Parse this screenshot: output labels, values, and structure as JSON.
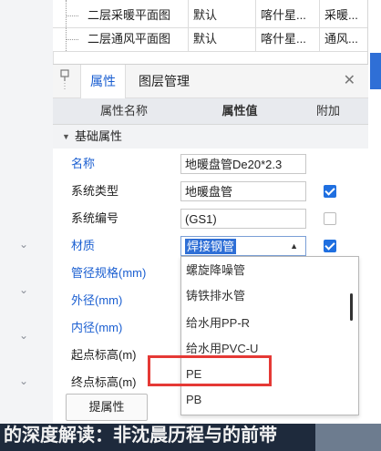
{
  "layers": {
    "rows": [
      {
        "name": "二层采暖平面图",
        "type": "默认",
        "author": "喀什星...",
        "extra": "采暖..."
      },
      {
        "name": "二层通风平面图",
        "type": "默认",
        "author": "喀什星...",
        "extra": "通风..."
      }
    ]
  },
  "panel": {
    "tabs": [
      {
        "label": "属性",
        "active": true
      },
      {
        "label": "图层管理",
        "active": false
      }
    ],
    "close_icon": "close-icon",
    "lock_icon": "pin-icon",
    "columns": {
      "name": "属性名称",
      "value": "属性值",
      "add": "附加"
    },
    "group_label": "基础属性",
    "rows": [
      {
        "name": "名称",
        "value": "地暖盘管De20*2.3",
        "blue": true,
        "checkbox": null
      },
      {
        "name": "系统类型",
        "value": "地暖盘管",
        "blue": false,
        "checkbox": true
      },
      {
        "name": "系统编号",
        "value": "(GS1)",
        "blue": false,
        "checkbox": false
      },
      {
        "name": "材质",
        "value": "焊接钢管",
        "blue": true,
        "checkbox": true
      },
      {
        "name": "管径规格(mm)",
        "value": "",
        "blue": true,
        "checkbox": null
      },
      {
        "name": "外径(mm)",
        "value": "",
        "blue": true,
        "checkbox": null
      },
      {
        "name": "内径(mm)",
        "value": "",
        "blue": true,
        "checkbox": null
      },
      {
        "name": "起点标高(m)",
        "value": "",
        "blue": false,
        "checkbox": null
      },
      {
        "name": "终点标高(m)",
        "value": "",
        "blue": false,
        "checkbox": null
      }
    ]
  },
  "dropdown": {
    "options": [
      "螺旋降噪管",
      "铸铁排水管",
      "给水用PP-R",
      "给水用PVC-U",
      "PE",
      "PB"
    ],
    "highlighted": "PE",
    "highlight_color": "#e53935"
  },
  "bottom_button": {
    "label": "提属性"
  },
  "bottom_banner": {
    "text": "的深度解读：非沈晨历程与的前带"
  },
  "colors": {
    "accent": "#1b5fd1",
    "checkbox": "#1f6fe0",
    "selection": "#2f6fd6"
  }
}
